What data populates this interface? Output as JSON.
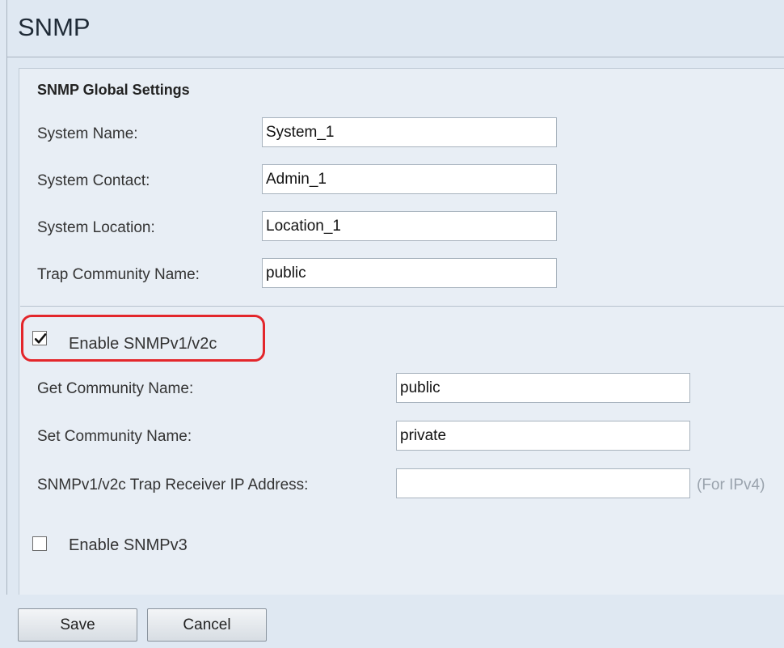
{
  "page": {
    "title": "SNMP"
  },
  "global_settings": {
    "heading": "SNMP Global Settings",
    "system_name": {
      "label": "System Name:",
      "value": "System_1"
    },
    "system_contact": {
      "label": "System Contact:",
      "value": "Admin_1"
    },
    "system_location": {
      "label": "System Location:",
      "value": "Location_1"
    },
    "trap_community": {
      "label": "Trap Community Name:",
      "value": "public"
    }
  },
  "snmpv1v2c": {
    "enable_label": "Enable SNMPv1/v2c",
    "enabled": true,
    "get_community": {
      "label": "Get Community Name:",
      "value": "public"
    },
    "set_community": {
      "label": "Set Community Name:",
      "value": "private"
    },
    "trap_receiver": {
      "label": "SNMPv1/v2c Trap Receiver IP Address:",
      "value": "",
      "hint": "(For IPv4)"
    }
  },
  "snmpv3": {
    "enable_label": "Enable SNMPv3",
    "enabled": false
  },
  "footer": {
    "save_label": "Save",
    "cancel_label": "Cancel"
  },
  "colors": {
    "highlight": "#e3262b",
    "panel_bg": "#e8eef5",
    "page_bg": "#dfe8f2"
  }
}
